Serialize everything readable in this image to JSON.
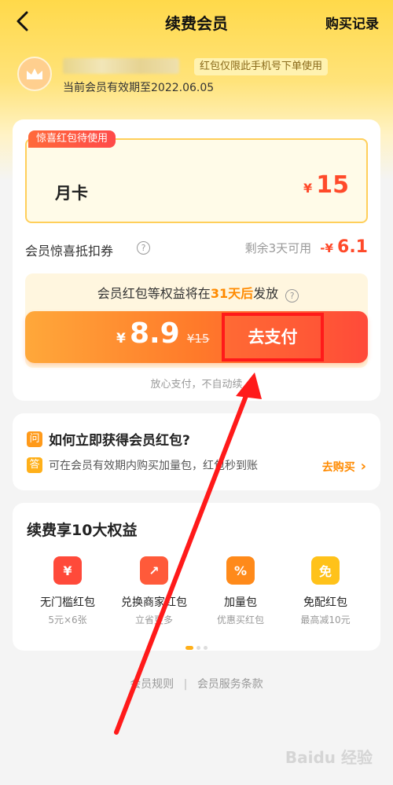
{
  "header": {
    "title": "续费会员",
    "records_label": "购买记录"
  },
  "user": {
    "tip": "红包仅限此手机号下单使用",
    "expire": "当前会员有效期至2022.06.05"
  },
  "product": {
    "tag": "惊喜红包待使用",
    "name": "月卡",
    "currency": "¥",
    "price": "15"
  },
  "coupon": {
    "label": "会员惊喜抵扣券",
    "help": "?",
    "remain": "剩余3天可用",
    "minus": "-¥",
    "amount": "6.1"
  },
  "benefit_notice": {
    "prefix": "会员红包等权益将在",
    "highlight": "31天后",
    "suffix": "发放",
    "help": "?"
  },
  "pay": {
    "currency": "¥",
    "price": "8.9",
    "original": "¥15",
    "button_label": "去支付",
    "safe_text": "放心支付，不自动续"
  },
  "faq": {
    "q_badge": "问",
    "question": "如何立即获得会员红包?",
    "a_badge": "答",
    "answer": "可在会员有效期内购买加量包，红包秒到账",
    "link": "去购买",
    "link_chevron": "›"
  },
  "benefits": {
    "title": "续费享10大权益",
    "items": [
      {
        "icon": "¥",
        "name": "无门槛红包",
        "sub": "5元×6张",
        "color": "#ff4a3a"
      },
      {
        "icon": "↗",
        "name": "兑换商家红包",
        "sub": "立省更多",
        "color": "#ff5a3a"
      },
      {
        "icon": "%",
        "name": "加量包",
        "sub": "优惠买红包",
        "color": "#ff8a1a"
      },
      {
        "icon": "免",
        "name": "免配红包",
        "sub": "最高减10元",
        "color": "#ffc21a"
      }
    ]
  },
  "footer": {
    "rules": "会员规则",
    "sep": "|",
    "terms": "会员服务条款"
  },
  "watermark": "Baidu 经验",
  "colors": {
    "accent": "#ff4a2a",
    "highlight": "#ff8a00",
    "annotation": "#ff1a1a"
  }
}
